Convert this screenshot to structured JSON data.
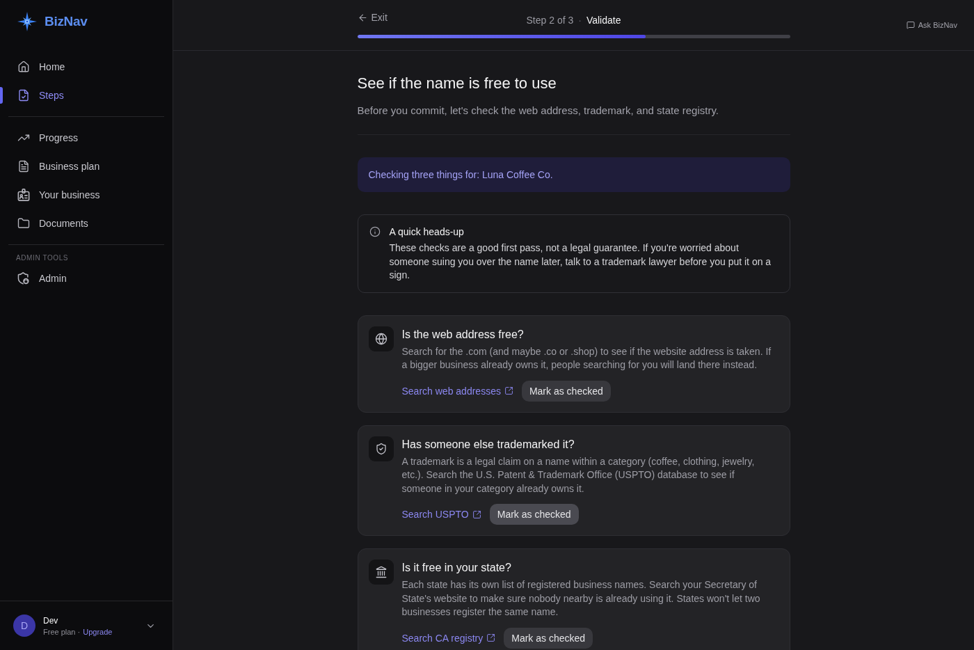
{
  "sidebar": {
    "brand": "BizNav",
    "sections": [
      {
        "items": [
          {
            "label": "Home",
            "selected": false
          },
          {
            "label": "Steps",
            "selected": true
          }
        ]
      },
      {
        "items": [
          {
            "label": "Progress",
            "selected": false
          },
          {
            "label": "Business plan",
            "selected": false
          },
          {
            "label": "Your business",
            "selected": false
          },
          {
            "label": "Documents",
            "selected": false
          }
        ]
      },
      {
        "heading": "ADMIN TOOLS",
        "items": [
          {
            "label": "Admin",
            "selected": false
          }
        ]
      }
    ],
    "user": {
      "initial": "D",
      "name": "Dev",
      "plan": "Free plan ·",
      "upgrade": "Upgrade"
    }
  },
  "header": {
    "exit": "Exit",
    "step": "Step 2 of 3",
    "separator": "·",
    "step_name": "Validate",
    "progress": {
      "level": 0.667
    },
    "ask": "Ask BizNav"
  },
  "content": {
    "title": "See if the name is free to use",
    "subtitle": "Before you commit, let's check the web address, trademark, and state registry.",
    "banner": "Checking three things for: Luna Coffee Co.",
    "notice": {
      "title": "A quick heads-up",
      "body": "These checks are a good first pass, not a legal guarantee. If you're worried about someone suing you over the name later, talk to a trademark lawyer before you put it on a sign."
    },
    "checks": [
      {
        "title": "Is the web address free?",
        "description": "Search for the .com (and maybe .co or .shop) to see if the website address is taken. If a bigger business already owns it, people searching for you will land there instead.",
        "link": "Search web addresses",
        "button": {
          "label": "Mark as checked",
          "hovered": false
        }
      },
      {
        "title": "Has someone else trademarked it?",
        "description": "A trademark is a legal claim on a name within a category (coffee, clothing, jewelry, etc.). Search the U.S. Patent & Trademark Office (USPTO) database to see if someone in your category already owns it.",
        "link": "Search USPTO",
        "button": {
          "label": "Mark as checked",
          "hovered": true
        }
      },
      {
        "title": "Is it free in your state?",
        "description": "Each state has its own list of registered business names. Search your Secretary of State's website to make sure nobody nearby is already using it. States won't let two businesses register the same name.",
        "link": "Search CA registry",
        "button": {
          "label": "Mark as checked",
          "hovered": false
        }
      }
    ]
  }
}
